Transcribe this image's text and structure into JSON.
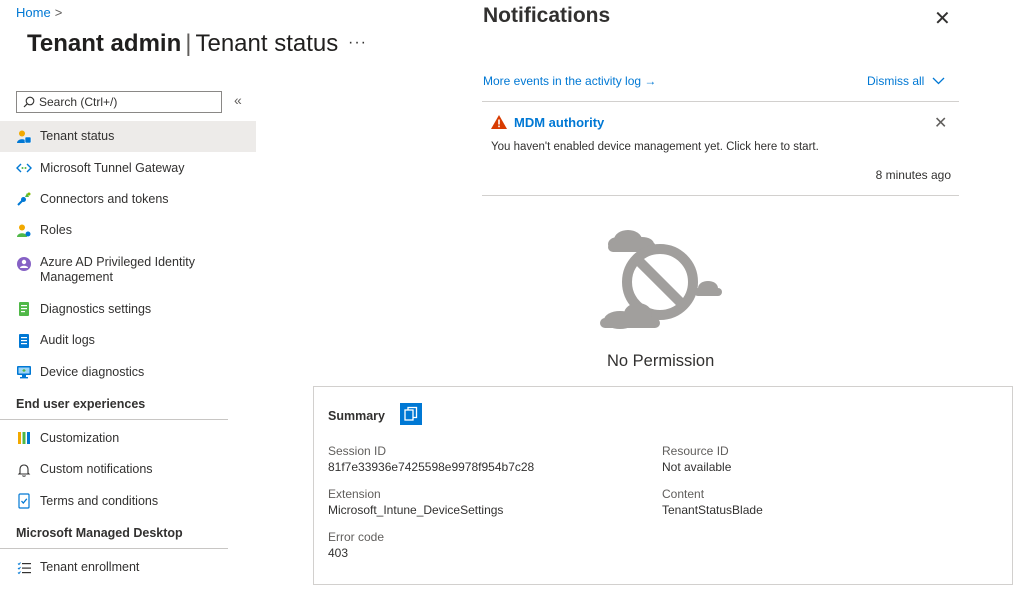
{
  "breadcrumb": {
    "home": "Home",
    "separator": ">"
  },
  "header": {
    "title_main": "Tenant admin",
    "title_sep": "|",
    "title_sub": "Tenant status",
    "more": "···"
  },
  "sidebar": {
    "search_placeholder": "Search (Ctrl+/)",
    "collapse": "«",
    "items": [
      {
        "label": "Tenant status",
        "icon": "tenant-status-icon"
      },
      {
        "label": "Microsoft Tunnel Gateway",
        "icon": "tunnel-gateway-icon"
      },
      {
        "label": "Connectors and tokens",
        "icon": "connectors-icon"
      },
      {
        "label": "Roles",
        "icon": "roles-icon"
      },
      {
        "label": "Azure AD Privileged Identity Management",
        "icon": "pim-icon"
      },
      {
        "label": "Diagnostics settings",
        "icon": "diagnostics-settings-icon"
      },
      {
        "label": "Audit logs",
        "icon": "audit-logs-icon"
      },
      {
        "label": "Device diagnostics",
        "icon": "device-diagnostics-icon"
      }
    ],
    "section_end_user": "End user experiences",
    "end_user_items": [
      {
        "label": "Customization",
        "icon": "customization-icon"
      },
      {
        "label": "Custom notifications",
        "icon": "bell-icon"
      },
      {
        "label": "Terms and conditions",
        "icon": "terms-icon"
      }
    ],
    "section_mmd": "Microsoft Managed Desktop",
    "mmd_items": [
      {
        "label": "Tenant enrollment",
        "icon": "enrollment-icon"
      }
    ]
  },
  "notifications": {
    "title": "Notifications",
    "close": "✕",
    "activity_link": "More events in the activity log →",
    "dismiss_all": "Dismiss all",
    "card": {
      "title": "MDM authority",
      "message": "You haven't enabled device management yet. Click here to start.",
      "time": "8 minutes ago",
      "close": "✕"
    }
  },
  "no_permission": {
    "text": "No Permission"
  },
  "summary": {
    "title": "Summary",
    "session_id_label": "Session ID",
    "session_id": "81f7e33936e7425598e9978f954b7c28",
    "extension_label": "Extension",
    "extension": "Microsoft_Intune_DeviceSettings",
    "error_code_label": "Error code",
    "error_code": "403",
    "resource_id_label": "Resource ID",
    "resource_id": "Not available",
    "content_label": "Content",
    "content": "TenantStatusBlade"
  },
  "colors": {
    "accent": "#0078d4",
    "warning": "#d83b01",
    "active_bg": "#edebe9"
  }
}
